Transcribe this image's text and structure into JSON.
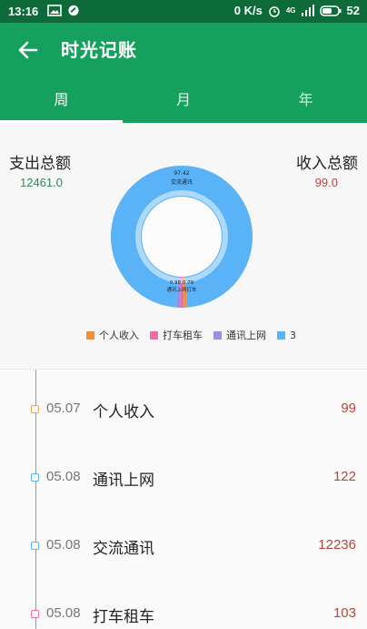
{
  "status": {
    "time": "13:16",
    "net_speed": "0 K/s",
    "network": "4G",
    "battery": "52"
  },
  "appbar": {
    "title": "时光记账",
    "back_icon": "arrow-left-icon"
  },
  "tabs": [
    {
      "label": "周"
    },
    {
      "label": "月"
    },
    {
      "label": "年"
    }
  ],
  "summary": {
    "expense_label": "支出总额",
    "expense_value": "12461.0",
    "income_label": "收入总额",
    "income_value": "99.0"
  },
  "chart_data": {
    "type": "pie",
    "labels": [
      "个人收入",
      "打车租车",
      "通讯上网",
      "交流通讯"
    ],
    "values": [
      99,
      103,
      122,
      12236
    ],
    "colors": [
      "#f0913a",
      "#ec6fa8",
      "#9b8ee6",
      "#5ab3f7"
    ],
    "slice_labels": {
      "top_value": "97.42",
      "top_name": "交流通讯",
      "bottom_value": "0.98 0.79",
      "bottom_name": "通讯上网打车"
    },
    "legend": [
      "个人收入",
      "打车租车",
      "通讯上网",
      "3"
    ]
  },
  "records": [
    {
      "date": "05.07",
      "name": "个人收入",
      "amount": "99",
      "icon_color": "#f0a04a"
    },
    {
      "date": "05.08",
      "name": "通讯上网",
      "amount": "122",
      "icon_color": "#5ab3f7"
    },
    {
      "date": "05.08",
      "name": "交流通讯",
      "amount": "12236",
      "icon_color": "#5ab3f7"
    },
    {
      "date": "05.08",
      "name": "打车租车",
      "amount": "103",
      "icon_color": "#ec6fa8"
    }
  ]
}
